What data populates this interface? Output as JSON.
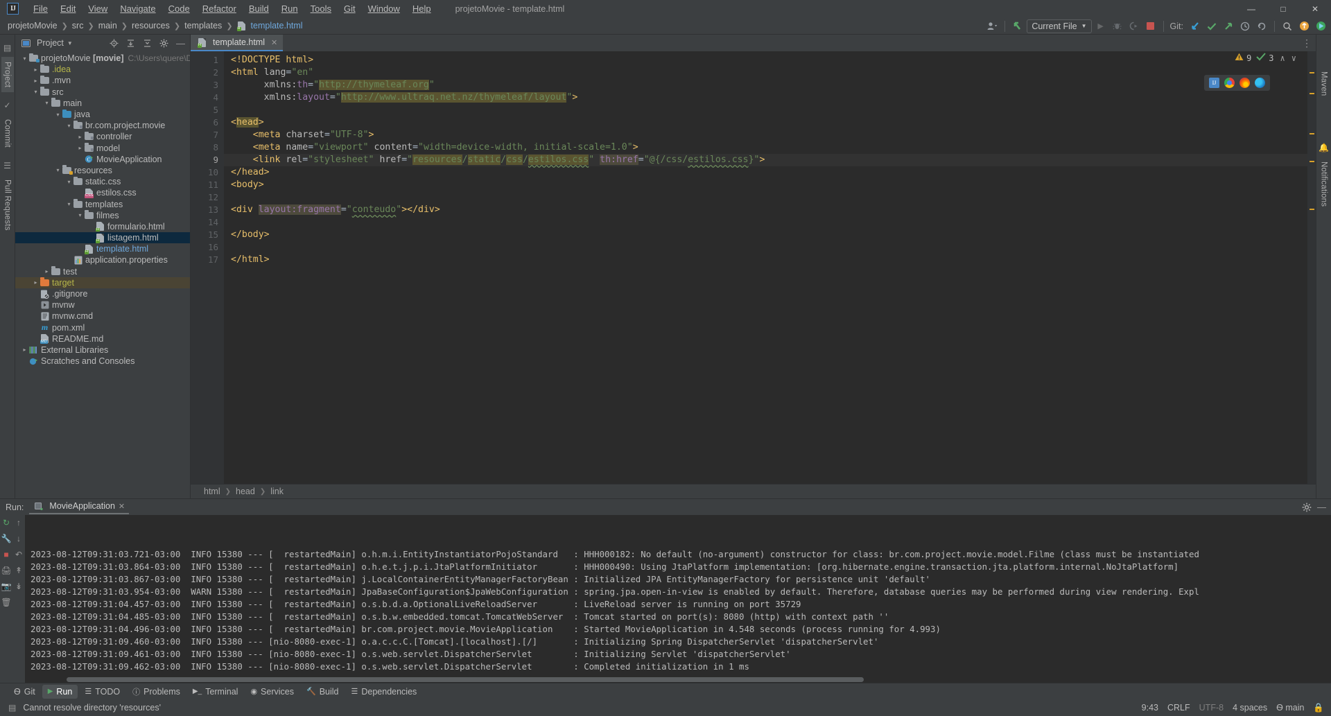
{
  "app": {
    "logo": "intellij-logo",
    "window_title": "projetoMovie - template.html"
  },
  "menubar": {
    "items": [
      "File",
      "Edit",
      "View",
      "Navigate",
      "Code",
      "Refactor",
      "Build",
      "Run",
      "Tools",
      "Git",
      "Window",
      "Help"
    ]
  },
  "window_controls": {
    "minimize": "—",
    "maximize": "□",
    "close": "✕"
  },
  "navbar": {
    "breadcrumbs": [
      "projetoMovie",
      "src",
      "main",
      "resources",
      "templates",
      "template.html"
    ],
    "run_config": "Current File",
    "git_label": "Git:",
    "icons": [
      "user-avatar-icon",
      "chevron-down-icon",
      "updating-arrow-icon",
      "run-icon",
      "debug-icon",
      "run-with-coverage-icon",
      "stop-icon",
      "git-update-icon",
      "git-commit-icon",
      "git-push-icon",
      "git-history-icon",
      "git-rollback-icon",
      "search-everywhere-icon",
      "notifications-icon",
      "ide-feature-icon"
    ]
  },
  "left_stripe": {
    "tabs": [
      "Project",
      "Commit",
      "Pull Requests"
    ]
  },
  "right_stripe": {
    "tabs": [
      "Maven",
      "Notifications"
    ]
  },
  "project_panel": {
    "title": "Project",
    "header_icons": [
      "locate-icon",
      "expand-all-icon",
      "collapse-all-icon",
      "settings-gear-icon",
      "hide-icon"
    ],
    "tree": [
      {
        "depth": 0,
        "arrow": "down",
        "icon": "module-folder-icon",
        "label": "projetoMovie",
        "bold_suffix": "[movie]",
        "sub": "C:\\Users\\quere\\Documents\\",
        "state": "normal"
      },
      {
        "depth": 1,
        "arrow": "right",
        "icon": "folder-icon",
        "label": ".idea",
        "color": "olive",
        "state": "normal"
      },
      {
        "depth": 1,
        "arrow": "right",
        "icon": "folder-icon",
        "label": ".mvn",
        "state": "normal"
      },
      {
        "depth": 1,
        "arrow": "down",
        "icon": "folder-icon",
        "label": "src",
        "state": "normal"
      },
      {
        "depth": 2,
        "arrow": "down",
        "icon": "folder-icon",
        "label": "main",
        "state": "normal"
      },
      {
        "depth": 3,
        "arrow": "down",
        "icon": "source-folder-icon",
        "label": "java",
        "state": "normal"
      },
      {
        "depth": 4,
        "arrow": "down",
        "icon": "package-icon",
        "label": "br.com.project.movie",
        "state": "normal"
      },
      {
        "depth": 5,
        "arrow": "right",
        "icon": "package-icon",
        "label": "controller",
        "state": "normal"
      },
      {
        "depth": 5,
        "arrow": "right",
        "icon": "package-icon",
        "label": "model",
        "state": "normal"
      },
      {
        "depth": 5,
        "arrow": "none",
        "icon": "java-class-run-icon",
        "label": "MovieApplication",
        "state": "normal"
      },
      {
        "depth": 3,
        "arrow": "down",
        "icon": "resource-folder-icon",
        "label": "resources",
        "state": "normal"
      },
      {
        "depth": 4,
        "arrow": "down",
        "icon": "folder-icon",
        "label": "static.css",
        "state": "normal"
      },
      {
        "depth": 5,
        "arrow": "none",
        "icon": "css-file-icon",
        "label": "estilos.css",
        "state": "normal"
      },
      {
        "depth": 4,
        "arrow": "down",
        "icon": "folder-icon",
        "label": "templates",
        "state": "normal"
      },
      {
        "depth": 5,
        "arrow": "down",
        "icon": "folder-icon",
        "label": "filmes",
        "state": "normal"
      },
      {
        "depth": 6,
        "arrow": "none",
        "icon": "html-file-icon",
        "label": "formulario.html",
        "state": "normal"
      },
      {
        "depth": 6,
        "arrow": "none",
        "icon": "html-file-icon",
        "label": "listagem.html",
        "state": "selected"
      },
      {
        "depth": 5,
        "arrow": "none",
        "icon": "html-file-icon",
        "label": "template.html",
        "color": "blue",
        "state": "normal"
      },
      {
        "depth": 4,
        "arrow": "none",
        "icon": "properties-file-icon",
        "label": "application.properties",
        "state": "normal"
      },
      {
        "depth": 2,
        "arrow": "right",
        "icon": "folder-icon",
        "label": "test",
        "state": "normal"
      },
      {
        "depth": 1,
        "arrow": "right",
        "icon": "excluded-folder-icon",
        "label": "target",
        "color": "olive",
        "state": "context"
      },
      {
        "depth": 1,
        "arrow": "none",
        "icon": "gitignore-file-icon",
        "label": ".gitignore",
        "state": "normal"
      },
      {
        "depth": 1,
        "arrow": "none",
        "icon": "script-file-icon",
        "label": "mvnw",
        "state": "normal"
      },
      {
        "depth": 1,
        "arrow": "none",
        "icon": "cmd-file-icon",
        "label": "mvnw.cmd",
        "state": "normal"
      },
      {
        "depth": 1,
        "arrow": "none",
        "icon": "maven-file-icon",
        "label": "pom.xml",
        "state": "normal"
      },
      {
        "depth": 1,
        "arrow": "none",
        "icon": "markdown-file-icon",
        "label": "README.md",
        "state": "normal"
      },
      {
        "depth": 0,
        "arrow": "right",
        "icon": "libraries-icon",
        "label": "External Libraries",
        "state": "normal"
      },
      {
        "depth": 0,
        "arrow": "none",
        "icon": "scratches-icon",
        "label": "Scratches and Consoles",
        "state": "normal"
      }
    ]
  },
  "editor": {
    "tab": {
      "label": "template.html",
      "icon": "html-file-icon",
      "close": "✕"
    },
    "inspections": {
      "warning_icon": "warning-triangle-icon",
      "warning_count": "9",
      "ok_icon": "inspection-ok-icon",
      "ok_count": "3",
      "prev": "∧",
      "next": "∨"
    },
    "browsers": [
      "chrome-icon",
      "firefox-icon",
      "edge-icon",
      "ij-builtin-preview-icon"
    ],
    "lines": [
      {
        "n": 1,
        "fold": "",
        "bulb": false,
        "current": false
      },
      {
        "n": 2,
        "fold": "-",
        "bulb": false,
        "current": false
      },
      {
        "n": 3,
        "fold": "",
        "bulb": false,
        "current": false
      },
      {
        "n": 4,
        "fold": "",
        "bulb": false,
        "current": false
      },
      {
        "n": 5,
        "fold": "",
        "bulb": false,
        "current": false
      },
      {
        "n": 6,
        "fold": "-",
        "bulb": false,
        "current": false
      },
      {
        "n": 7,
        "fold": "",
        "bulb": false,
        "current": false
      },
      {
        "n": 8,
        "fold": "",
        "bulb": false,
        "current": false
      },
      {
        "n": 9,
        "fold": "",
        "bulb": true,
        "current": true
      },
      {
        "n": 10,
        "fold": "-",
        "bulb": false,
        "current": false
      },
      {
        "n": 11,
        "fold": "-",
        "bulb": false,
        "current": false
      },
      {
        "n": 12,
        "fold": "",
        "bulb": false,
        "current": false
      },
      {
        "n": 13,
        "fold": "",
        "bulb": false,
        "current": false
      },
      {
        "n": 14,
        "fold": "",
        "bulb": false,
        "current": false
      },
      {
        "n": 15,
        "fold": "-",
        "bulb": false,
        "current": false
      },
      {
        "n": 16,
        "fold": "",
        "bulb": false,
        "current": false
      },
      {
        "n": 17,
        "fold": "-",
        "bulb": false,
        "current": false
      }
    ],
    "code_plain": [
      "<!DOCTYPE html>",
      "<html lang=\"en\"",
      "      xmlns:th=\"http://thymeleaf.org\"",
      "      xmlns:layout=\"http://www.ultraq.net.nz/thymeleaf/layout\">",
      "",
      "<head>",
      "    <meta charset=\"UTF-8\">",
      "    <meta name=\"viewport\" content=\"width=device-width, initial-scale=1.0\">",
      "    <link rel=\"stylesheet\" href=\"resources/static/css/estilos.css\" th:href=\"@{/css/estilos.css}\">",
      "</head>",
      "<body>",
      "",
      "<div layout:fragment=\"conteudo\"></div>",
      "",
      "</body>",
      "",
      "</html>"
    ],
    "breadcrumbs": [
      "html",
      "head",
      "link"
    ]
  },
  "run_panel": {
    "label": "Run:",
    "tab": "MovieApplication",
    "tab_close": "✕",
    "side_icons": [
      "rerun-icon",
      "scroll-up-icon",
      "wrench-icon",
      "scroll-down-icon",
      "stop-icon",
      "soft-wrap-icon",
      "up-stacktrace-icon",
      "down-stacktrace-icon",
      "print-icon",
      "camera-icon",
      "trash-icon"
    ],
    "header_icons": [
      "settings-gear-icon",
      "hide-icon"
    ],
    "lines": [
      {
        "ts": "2023-08-12T09:31:03.721-03:00",
        "level": "INFO",
        "pid": "15380",
        "thread": "restartedMain",
        "logger": "o.h.m.i.EntityInstantiatorPojoStandard",
        "msg": "HHH000182: No default (no-argument) constructor for class: br.com.project.movie.model.Filme (class must be instantiated"
      },
      {
        "ts": "2023-08-12T09:31:03.864-03:00",
        "level": "INFO",
        "pid": "15380",
        "thread": "restartedMain",
        "logger": "o.h.e.t.j.p.i.JtaPlatformInitiator",
        "msg": "HHH000490: Using JtaPlatform implementation: [org.hibernate.engine.transaction.jta.platform.internal.NoJtaPlatform]"
      },
      {
        "ts": "2023-08-12T09:31:03.867-03:00",
        "level": "INFO",
        "pid": "15380",
        "thread": "restartedMain",
        "logger": "j.LocalContainerEntityManagerFactoryBean",
        "msg": "Initialized JPA EntityManagerFactory for persistence unit 'default'"
      },
      {
        "ts": "2023-08-12T09:31:03.954-03:00",
        "level": "WARN",
        "pid": "15380",
        "thread": "restartedMain",
        "logger": "JpaBaseConfiguration$JpaWebConfiguration",
        "msg": "spring.jpa.open-in-view is enabled by default. Therefore, database queries may be performed during view rendering. Expl"
      },
      {
        "ts": "2023-08-12T09:31:04.457-03:00",
        "level": "INFO",
        "pid": "15380",
        "thread": "restartedMain",
        "logger": "o.s.b.d.a.OptionalLiveReloadServer",
        "msg": "LiveReload server is running on port 35729"
      },
      {
        "ts": "2023-08-12T09:31:04.485-03:00",
        "level": "INFO",
        "pid": "15380",
        "thread": "restartedMain",
        "logger": "o.s.b.w.embedded.tomcat.TomcatWebServer",
        "msg": "Tomcat started on port(s): 8080 (http) with context path ''"
      },
      {
        "ts": "2023-08-12T09:31:04.496-03:00",
        "level": "INFO",
        "pid": "15380",
        "thread": "restartedMain",
        "logger": "br.com.project.movie.MovieApplication",
        "msg": "Started MovieApplication in 4.548 seconds (process running for 4.993)"
      },
      {
        "ts": "2023-08-12T09:31:09.460-03:00",
        "level": "INFO",
        "pid": "15380",
        "thread": "nio-8080-exec-1",
        "logger": "o.a.c.c.C.[Tomcat].[localhost].[/]",
        "msg": "Initializing Spring DispatcherServlet 'dispatcherServlet'"
      },
      {
        "ts": "2023-08-12T09:31:09.461-03:00",
        "level": "INFO",
        "pid": "15380",
        "thread": "nio-8080-exec-1",
        "logger": "o.s.web.servlet.DispatcherServlet",
        "msg": "Initializing Servlet 'dispatcherServlet'"
      },
      {
        "ts": "2023-08-12T09:31:09.462-03:00",
        "level": "INFO",
        "pid": "15380",
        "thread": "nio-8080-exec-1",
        "logger": "o.s.web.servlet.DispatcherServlet",
        "msg": "Completed initialization in 1 ms"
      }
    ]
  },
  "bottom_tabs": [
    {
      "label": "Git",
      "icon": "git-branch-icon",
      "selected": false
    },
    {
      "label": "Run",
      "icon": "run-icon",
      "selected": true
    },
    {
      "label": "TODO",
      "icon": "todo-icon",
      "selected": false
    },
    {
      "label": "Problems",
      "icon": "problems-icon",
      "selected": false
    },
    {
      "label": "Terminal",
      "icon": "terminal-icon",
      "selected": false
    },
    {
      "label": "Services",
      "icon": "services-icon",
      "selected": false
    },
    {
      "label": "Build",
      "icon": "build-hammer-icon",
      "selected": false
    },
    {
      "label": "Dependencies",
      "icon": "dependencies-icon",
      "selected": false
    }
  ],
  "statusbar": {
    "message_icon": "info-icon",
    "message": "Cannot resolve directory 'resources'",
    "caret_position": "9:43",
    "line_separator": "CRLF",
    "encoding": "UTF-8",
    "indent": "4 spaces",
    "branch_icon": "git-branch-icon",
    "branch": "main",
    "lock_icon": "lock-icon"
  },
  "colors": {
    "accent_blue": "#4a88c7",
    "selection": "#0d293e",
    "context_row": "#4a4434",
    "string_green": "#6a8759",
    "tag_yellow": "#e8bf6a",
    "ns_purple": "#9876aa",
    "warning_amber": "#d8a12a",
    "ok_green": "#5c9e31"
  }
}
